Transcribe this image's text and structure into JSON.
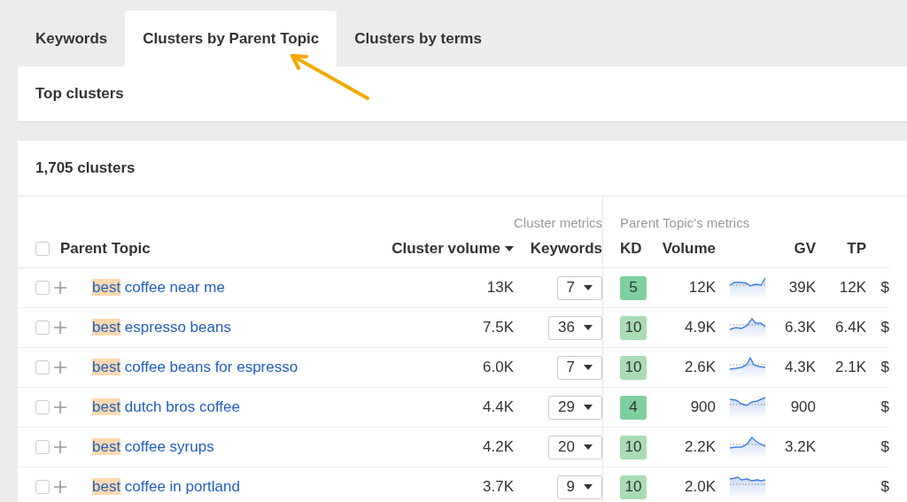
{
  "tabs": [
    {
      "label": "Keywords",
      "selected": false
    },
    {
      "label": "Clusters by Parent Topic",
      "selected": true
    },
    {
      "label": "Clusters by terms",
      "selected": false
    }
  ],
  "top_panel": {
    "title": "Top clusters"
  },
  "results": {
    "count": "1,705 clusters"
  },
  "table": {
    "groups": {
      "cluster": "Cluster metrics",
      "parent": "Parent Topic’s metrics"
    },
    "select_all": {
      "checked": false
    },
    "columns": [
      {
        "label": "Parent Topic",
        "sorted": false
      },
      {
        "label": "Cluster volume",
        "sorted": true
      },
      {
        "label": "Keywords",
        "sorted": false
      },
      {
        "label": "KD",
        "sorted": false
      },
      {
        "label": "Volume",
        "sorted": false
      },
      {
        "label": "GV",
        "sorted": false
      },
      {
        "label": "TP",
        "sorted": false
      }
    ],
    "rows": [
      {
        "checked": false,
        "match": "best",
        "rest": " coffee near me",
        "cluster_volume": "13K",
        "keywords": "7",
        "kd": {
          "text": "5",
          "color": "#7fcf9f"
        },
        "volume": "12K",
        "gv": "39K",
        "tp": "12K",
        "column_9": "$"
      },
      {
        "checked": false,
        "match": "best",
        "rest": " espresso beans",
        "cluster_volume": "7.5K",
        "keywords": "36",
        "kd": {
          "text": "10",
          "color": "#a9dcb4"
        },
        "volume": "4.9K",
        "gv": "6.3K",
        "tp": "6.4K",
        "column_9": "$"
      },
      {
        "checked": false,
        "match": "best",
        "rest": " coffee beans for espresso",
        "cluster_volume": "6.0K",
        "keywords": "7",
        "kd": {
          "text": "10",
          "color": "#a9dcb4"
        },
        "volume": "2.6K",
        "gv": "4.3K",
        "tp": "2.1K",
        "column_9": "$"
      },
      {
        "checked": false,
        "match": "best",
        "rest": " dutch bros coffee",
        "cluster_volume": "4.4K",
        "keywords": "29",
        "kd": {
          "text": "4",
          "color": "#7fcf9f"
        },
        "volume": "900",
        "gv": "900",
        "column_9": "$"
      },
      {
        "checked": false,
        "match": "best",
        "rest": " coffee syrups",
        "cluster_volume": "4.2K",
        "keywords": "20",
        "kd": {
          "text": "10",
          "color": "#a9dcb4"
        },
        "volume": "2.2K",
        "gv": "3.2K",
        "column_9": "$"
      },
      {
        "checked": false,
        "match": "best",
        "rest": " coffee in portland",
        "cluster_volume": "3.7K",
        "keywords": "9",
        "kd": {
          "text": "10",
          "color": "#a9dcb4"
        },
        "volume": "2.0K",
        "column_9": "$"
      }
    ]
  }
}
